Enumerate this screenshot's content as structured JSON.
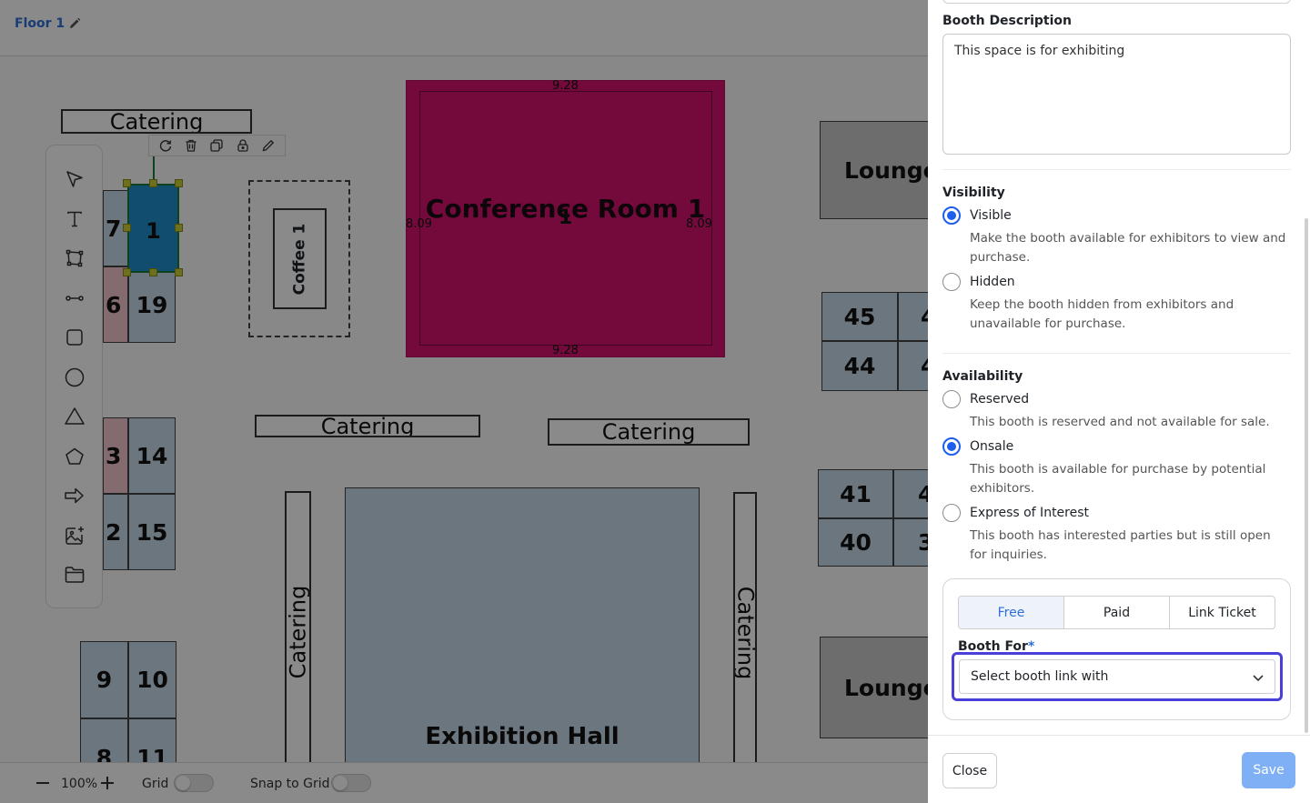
{
  "header": {
    "floor_name": "Floor 1"
  },
  "plan": {
    "catering_labels": [
      "Catering",
      "Catering",
      "Catering",
      "Catering",
      "Catering"
    ],
    "coffee_label": "Coffee 1",
    "conference": {
      "label": "Conference Room 1",
      "number": "1",
      "dim_top": "9.28",
      "dim_bottom": "9.28",
      "dim_left": "8.09",
      "dim_right": "8.09"
    },
    "exhibition_label": "Exhibition Hall",
    "lounge_labels": [
      "Lounge",
      "Lounge"
    ],
    "booths": [
      "7",
      "6",
      "19",
      "3",
      "14",
      "2",
      "15",
      "9",
      "10",
      "8",
      "11",
      "45",
      "44",
      "41",
      "40",
      "4",
      "4",
      "4",
      "3"
    ],
    "selected_booth_number": "1"
  },
  "bottom_bar": {
    "zoom": "100%",
    "grid_label": "Grid",
    "snap_label": "Snap to Grid"
  },
  "drawer": {
    "booth_description_label": "Booth Description",
    "booth_description_value": "This space is for exhibiting",
    "visibility": {
      "label": "Visibility",
      "options": [
        {
          "label": "Visible",
          "desc": "Make the booth available for exhibitors to view and purchase.",
          "selected": true
        },
        {
          "label": "Hidden",
          "desc": "Keep the booth hidden from exhibitors and unavailable for purchase.",
          "selected": false
        }
      ]
    },
    "availability": {
      "label": "Availability",
      "options": [
        {
          "label": "Reserved",
          "desc": "This booth is reserved and not available for sale.",
          "selected": false
        },
        {
          "label": "Onsale",
          "desc": "This booth is available for purchase by potential exhibitors.",
          "selected": true
        },
        {
          "label": "Express of Interest",
          "desc": "This booth has interested parties but is still open for inquiries.",
          "selected": false
        }
      ]
    },
    "pricing_tabs": [
      "Free",
      "Paid",
      "Link Ticket"
    ],
    "active_pricing_tab": "Free",
    "booth_for": {
      "label": "Booth For",
      "required_mark": "*",
      "value": "Select booth link with"
    },
    "close_label": "Close",
    "save_label": "Save"
  },
  "colors": {
    "accent": "#1d5ef0",
    "conference": "#d6146f",
    "booth": "#c8daea",
    "selected_booth": "#1f8fcc",
    "focus_ring": "#4a3fd6",
    "save": "#7fb0f5"
  }
}
